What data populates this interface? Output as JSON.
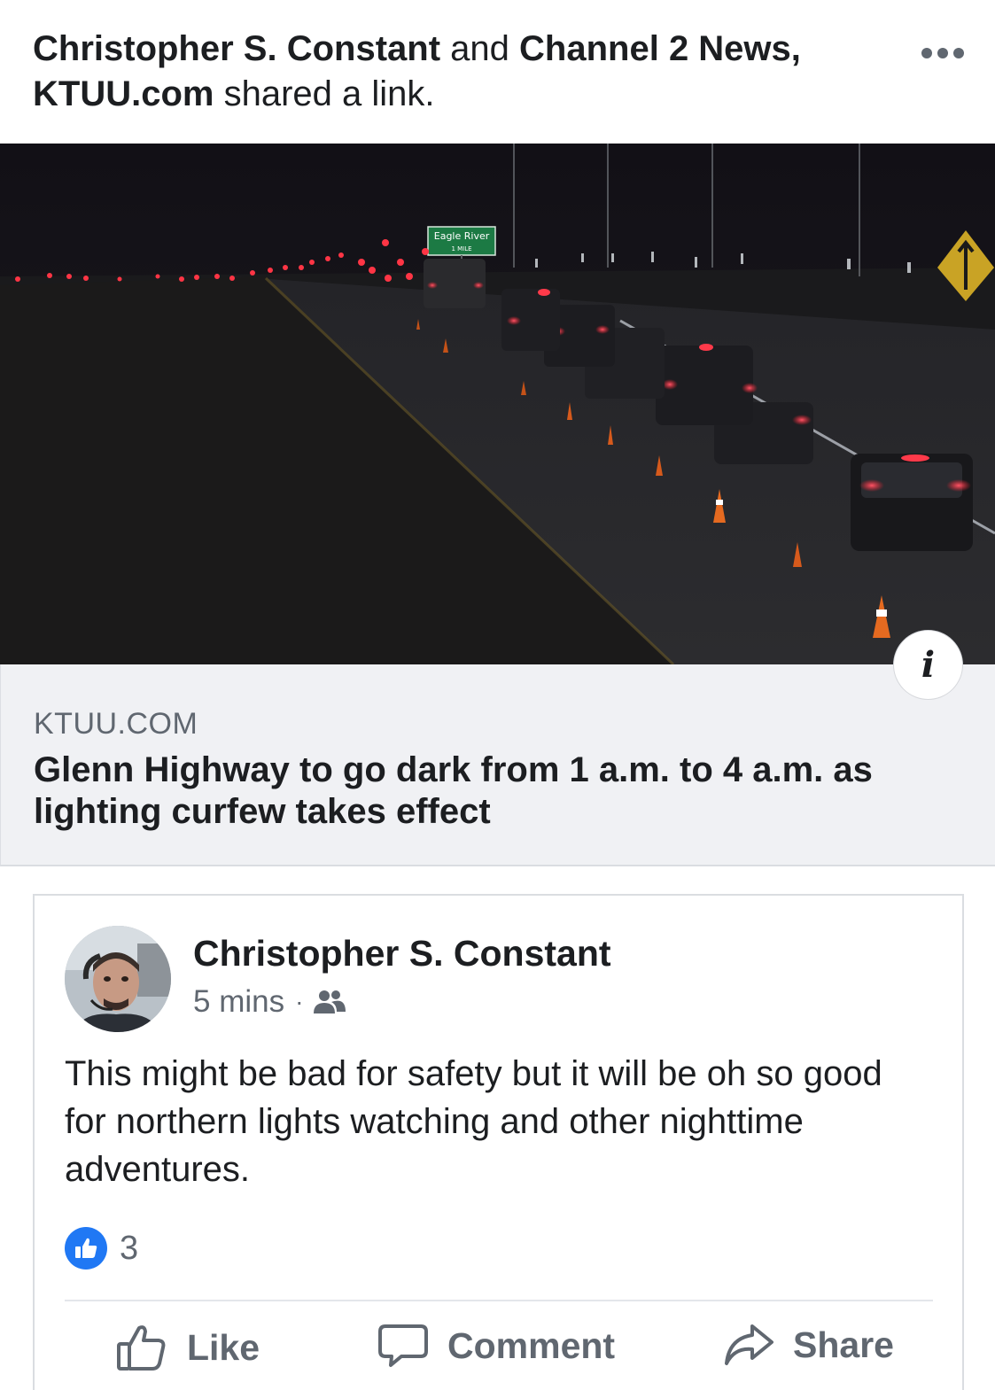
{
  "header": {
    "actor1": "Christopher S. Constant",
    "conj": "and",
    "actor2": "Channel 2 News, KTUU.com",
    "action": "shared a link.",
    "more_icon": "more-horizontal-icon"
  },
  "link_preview": {
    "image_sign_text": "Eagle River",
    "image_sign_subtext": "1 MILE",
    "info_icon": "info-icon",
    "info_symbol": "i",
    "domain": "KTUU.COM",
    "title": "Glenn Highway to go dark from 1 a.m. to 4 a.m. as lighting curfew takes effect"
  },
  "post": {
    "author": "Christopher S. Constant",
    "time": "5 mins",
    "separator": "·",
    "audience_icon": "friends-icon",
    "text": "This might be bad for safety but it will be oh so good for northern lights watching and other nighttime adventures.",
    "reaction_icon": "thumbs-up-icon",
    "reaction_count": "3",
    "actions": {
      "like": "Like",
      "comment": "Comment",
      "share": "Share"
    }
  },
  "colors": {
    "text": "#1c1e21",
    "secondary": "#606770",
    "link_bg": "#f0f1f4",
    "brand_blue": "#2078f4",
    "tail_light": "#ff2a3a"
  }
}
